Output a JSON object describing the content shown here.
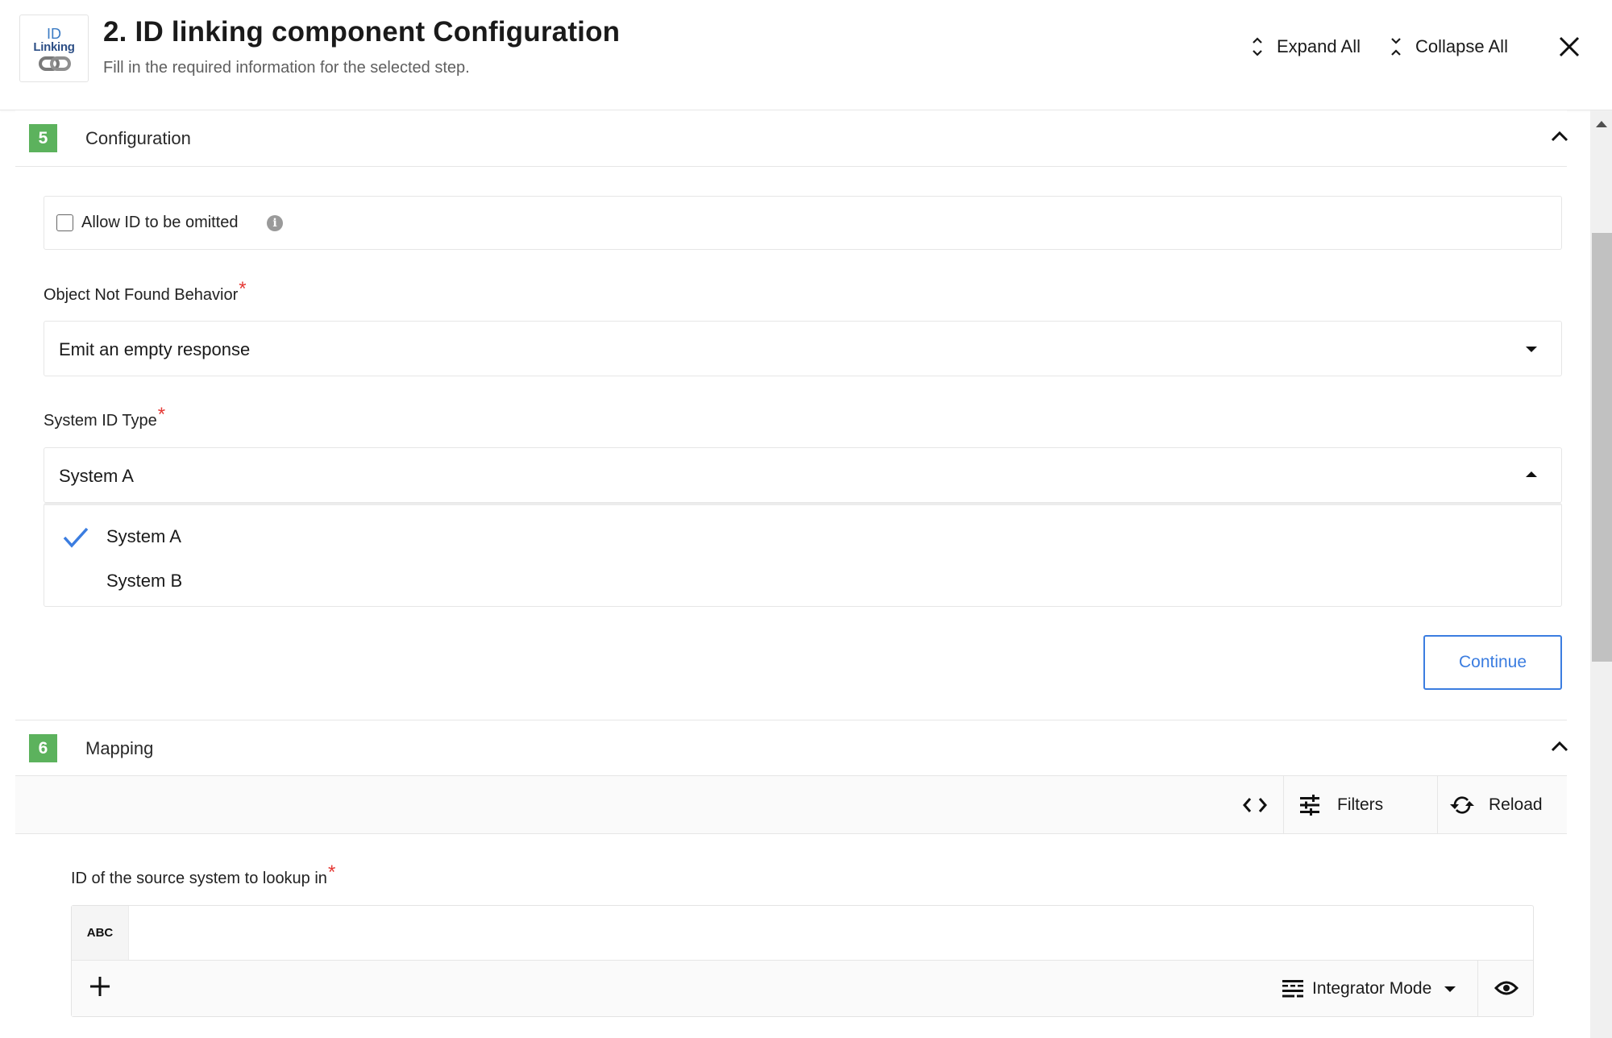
{
  "header": {
    "logo": {
      "line1": "ID",
      "line2": "Linking",
      "icon": "chain-link-icon"
    },
    "title": "2. ID linking component Configuration",
    "subtitle": "Fill in the required information for the selected step.",
    "expand_all": "Expand All",
    "collapse_all": "Collapse All",
    "close_icon": "close-icon"
  },
  "configuration": {
    "step_number": "5",
    "title": "Configuration",
    "allow_id_omitted": {
      "label": "Allow ID to be omitted",
      "checked": false,
      "info_icon": "i"
    },
    "object_not_found": {
      "label": "Object Not Found Behavior",
      "required_mark": "*",
      "value": "Emit an empty response"
    },
    "system_id_type": {
      "label": "System ID Type",
      "required_mark": "*",
      "value": "System A",
      "expanded": true,
      "options": [
        {
          "label": "System A",
          "selected": true
        },
        {
          "label": "System B",
          "selected": false
        }
      ]
    },
    "continue_label": "Continue"
  },
  "mapping": {
    "step_number": "6",
    "title": "Mapping",
    "toolbar": {
      "code_icon": "code-icon",
      "filters_label": "Filters",
      "reload_label": "Reload"
    },
    "field": {
      "label": "ID of the source system to lookup in",
      "required_mark": "*",
      "type_tag": "ABC",
      "value": "",
      "mode_label": "Integrator Mode"
    }
  },
  "colors": {
    "accent_blue": "#3b7de0",
    "badge_green": "#5cb25d",
    "required_red": "#e53935"
  }
}
